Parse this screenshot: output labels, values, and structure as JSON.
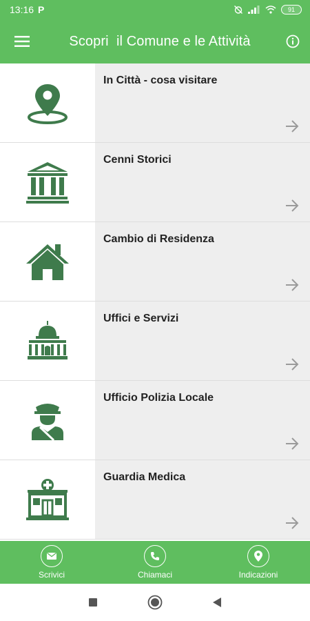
{
  "status_bar": {
    "time": "13:16",
    "carrier_glyph": "P",
    "battery": "91",
    "icons": [
      "alarm-off-icon",
      "signal-icon",
      "wifi-icon",
      "battery-icon"
    ]
  },
  "app_bar": {
    "title": "Scopri  il Comune e le Attività",
    "menu_icon": "hamburger-menu-icon",
    "info_icon": "info-icon"
  },
  "items": [
    {
      "label": "In Città - cosa visitare",
      "icon": "map-pin-icon"
    },
    {
      "label": "Cenni Storici",
      "icon": "museum-icon"
    },
    {
      "label": "Cambio di Residenza",
      "icon": "home-icon"
    },
    {
      "label": "Uffici e Servizi",
      "icon": "government-building-icon"
    },
    {
      "label": "Ufficio Polizia Locale",
      "icon": "police-officer-icon"
    },
    {
      "label": "Guardia Medica",
      "icon": "hospital-icon"
    }
  ],
  "bottom_nav": [
    {
      "label": "Scrivici",
      "icon": "mail-icon"
    },
    {
      "label": "Chiamaci",
      "icon": "phone-icon"
    },
    {
      "label": "Indicazioni",
      "icon": "location-icon"
    }
  ],
  "colors": {
    "primary": "#5fbe5f",
    "icon": "#3f7b4c",
    "row_bg": "#eeeeee",
    "arrow": "#9a9a9a"
  }
}
